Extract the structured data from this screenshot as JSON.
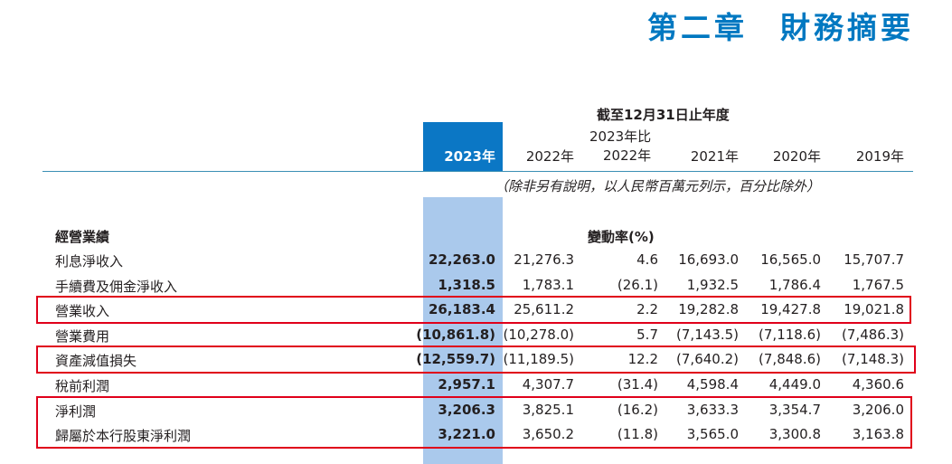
{
  "header": {
    "chapter": "第二章",
    "title": "財務摘要"
  },
  "table": {
    "period_caption": "截至12月31日止年度",
    "columns": [
      "2023年",
      "2022年",
      "2023年比\n2022年",
      "2021年",
      "2020年",
      "2019年"
    ],
    "unit_note": "（除非另有說明，以人民幣百萬元列示，百分比除外）",
    "section": {
      "title": "經營業績",
      "change_label": "變動率(%)"
    },
    "rows": [
      {
        "label": "利息淨收入",
        "values": [
          "22,263.0",
          "21,276.3",
          "4.6",
          "16,693.0",
          "16,565.0",
          "15,707.7"
        ]
      },
      {
        "label": "手續費及佣金淨收入",
        "values": [
          "1,318.5",
          "1,783.1",
          "(26.1)",
          "1,932.5",
          "1,786.4",
          "1,767.5"
        ]
      },
      {
        "label": "營業收入",
        "values": [
          "26,183.4",
          "25,611.2",
          "2.2",
          "19,282.8",
          "19,427.8",
          "19,021.8"
        ]
      },
      {
        "label": "營業費用",
        "values": [
          "(10,861.8)",
          "(10,278.0)",
          "5.7",
          "(7,143.5)",
          "(7,118.6)",
          "(7,486.3)"
        ]
      },
      {
        "label": "資產減值損失",
        "values": [
          "(12,559.7)",
          "(11,189.5)",
          "12.2",
          "(7,640.2)",
          "(7,848.6)",
          "(7,148.3)"
        ]
      },
      {
        "label": "稅前利潤",
        "values": [
          "2,957.1",
          "4,307.7",
          "(31.4)",
          "4,598.4",
          "4,449.0",
          "4,360.6"
        ]
      },
      {
        "label": "淨利潤",
        "values": [
          "3,206.3",
          "3,825.1",
          "(16.2)",
          "3,633.3",
          "3,354.7",
          "3,206.0"
        ]
      },
      {
        "label": "歸屬於本行股東淨利潤",
        "values": [
          "3,221.0",
          "3,650.2",
          "(11.8)",
          "3,565.0",
          "3,300.8",
          "3,163.8"
        ]
      }
    ]
  }
}
